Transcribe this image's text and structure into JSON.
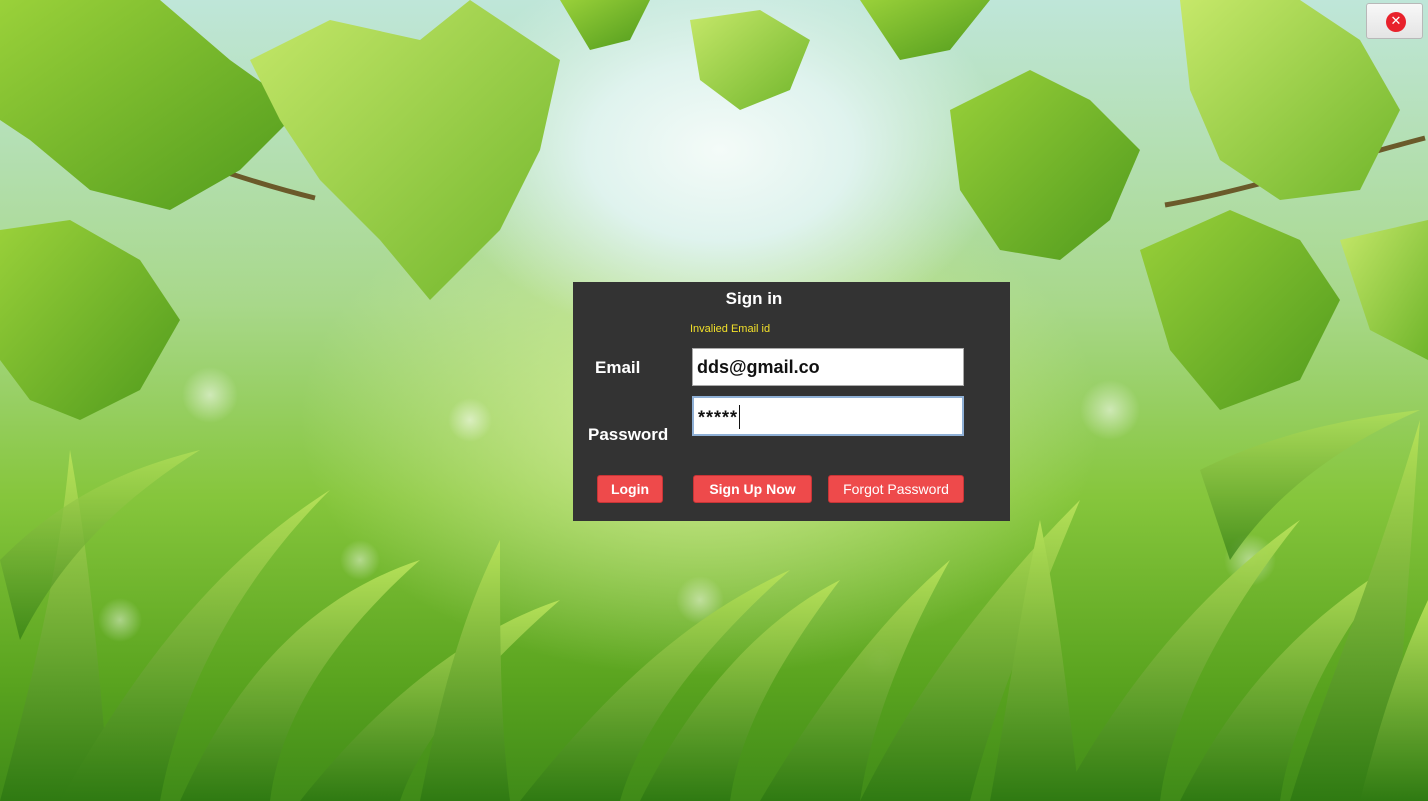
{
  "window": {
    "close_glyph": "✕",
    "close_icon": "close-icon",
    "close_color": "#e8212b"
  },
  "background": {
    "description_icon": "nature-leaves-grass-wallpaper"
  },
  "signin": {
    "title": "Sign in",
    "error_message": "Invalied Email id",
    "error_color": "#f2e02a",
    "email_label": "Email",
    "email_value": "dds@gmail.co",
    "password_label": "Password",
    "password_value": "*****",
    "panel_color": "#333333"
  },
  "buttons": {
    "login_label": "Login",
    "signup_label": "Sign Up Now",
    "forgot_label": "Forgot Password",
    "accent_color": "#ee4a4b"
  }
}
